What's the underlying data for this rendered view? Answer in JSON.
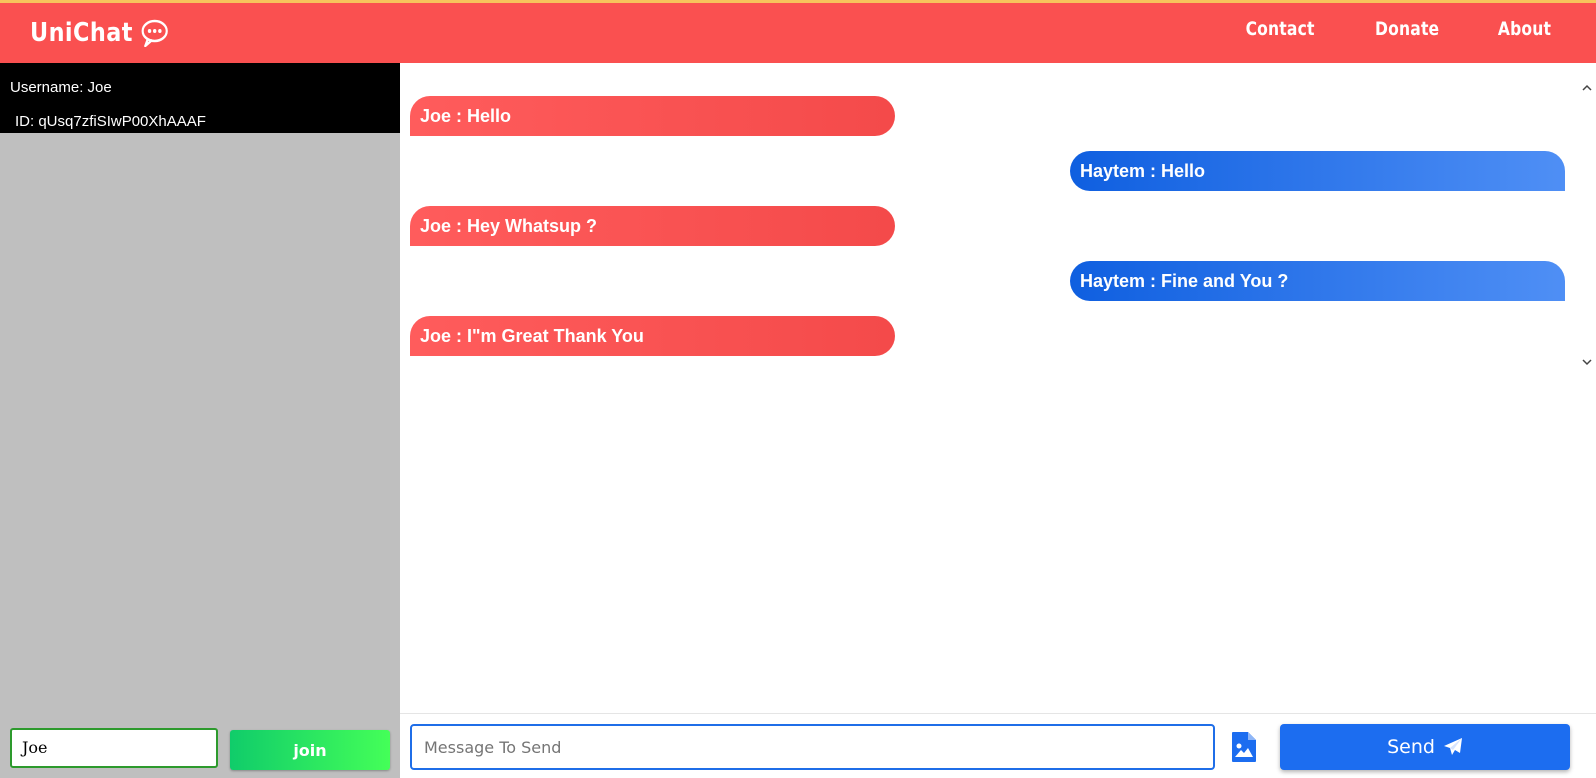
{
  "header": {
    "brand": "UniChat",
    "brand_icon": "chat-bubble-icon",
    "accent_color": "#fa5050",
    "nav": [
      {
        "label": "Contact"
      },
      {
        "label": "Donate"
      },
      {
        "label": "About"
      }
    ]
  },
  "sidebar": {
    "username_line": "Username: Joe",
    "id_line": "ID: qUsq7zfiSIwP00XhAAAF",
    "join_input_value": "Joe",
    "join_button_label": "join"
  },
  "messages": [
    {
      "sender": "Joe",
      "text": "Joe : Hello",
      "side": "left"
    },
    {
      "sender": "Haytem",
      "text": "Haytem : Hello",
      "side": "right"
    },
    {
      "sender": "Joe",
      "text": "Joe : Hey Whatsup ?",
      "side": "left"
    },
    {
      "sender": "Haytem",
      "text": "Haytem : Fine and You ?",
      "side": "right"
    },
    {
      "sender": "Joe",
      "text": "Joe : I\"m Great Thank You",
      "side": "left"
    }
  ],
  "composer": {
    "placeholder": "Message To Send",
    "image_icon": "image-file-icon",
    "send_label": "Send",
    "send_icon": "paper-plane-icon"
  }
}
